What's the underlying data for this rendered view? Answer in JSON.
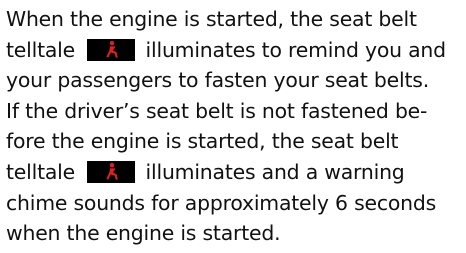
{
  "lines": [
    {
      "pre": "When the engine is started, the seat belt"
    },
    {
      "pre": "telltale",
      "icon": "seat-belt-telltale-icon",
      "post": "illuminates to remind you and"
    },
    {
      "pre": "your passengers to fasten your seat belts."
    },
    {
      "pre": "If the driver’s seat belt is not fastened be-"
    },
    {
      "pre": "fore the engine is started, the seat belt"
    },
    {
      "pre": "telltale",
      "icon": "seat-belt-telltale-icon",
      "post": "illuminates and a warning"
    },
    {
      "pre": "chime sounds for approximately 6 seconds"
    },
    {
      "pre": "when the engine is started."
    }
  ],
  "colors": {
    "text": "#111111",
    "telltale_background": "#000000",
    "telltale_symbol": "#e02020"
  }
}
